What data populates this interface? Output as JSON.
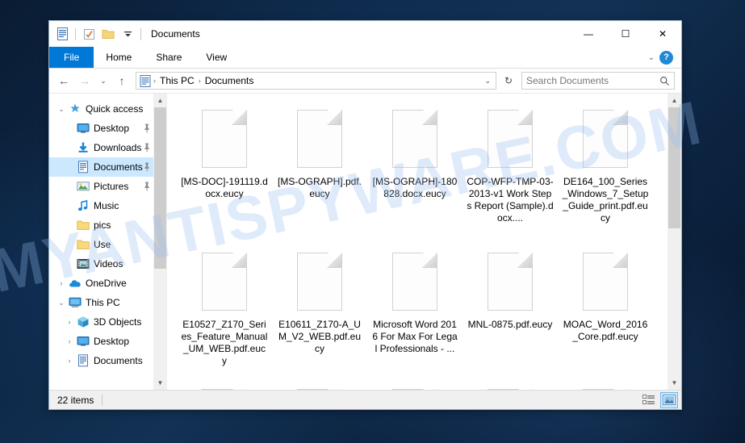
{
  "window": {
    "title": "Documents",
    "quick_access_toolbar": [
      {
        "name": "documents-folder-icon",
        "glyph": "doc"
      },
      {
        "name": "properties-icon",
        "glyph": "check"
      },
      {
        "name": "new-folder-icon",
        "glyph": "folder"
      },
      {
        "name": "customize-qat-dropdown",
        "glyph": "▾"
      }
    ],
    "controls": {
      "minimize": "—",
      "maximize": "☐",
      "close": "✕"
    }
  },
  "ribbon": {
    "tabs": [
      {
        "label": "File",
        "active": true
      },
      {
        "label": "Home",
        "active": false
      },
      {
        "label": "Share",
        "active": false
      },
      {
        "label": "View",
        "active": false
      }
    ],
    "collapse_glyph": "⌄",
    "help_glyph": "?"
  },
  "address": {
    "back_glyph": "←",
    "forward_glyph": "→",
    "recent_glyph": "⌄",
    "up_glyph": "↑",
    "crumbs": [
      "This PC",
      "Documents"
    ],
    "crumb_sep": "›",
    "crumb_chevron": "⌄",
    "refresh_glyph": "↻"
  },
  "search": {
    "placeholder": "Search Documents",
    "icon": "search-icon",
    "icon_glyph": "⌕"
  },
  "sidebar": {
    "items": [
      {
        "label": "Quick access",
        "icon": "pin-star-icon",
        "twisty": "⌄",
        "indent": 0,
        "pinned": false,
        "selected": false
      },
      {
        "label": "Desktop",
        "icon": "desktop-icon",
        "twisty": "",
        "indent": 1,
        "pinned": true,
        "selected": false
      },
      {
        "label": "Downloads",
        "icon": "downloads-icon",
        "twisty": "",
        "indent": 1,
        "pinned": true,
        "selected": false
      },
      {
        "label": "Documents",
        "icon": "documents-icon",
        "twisty": "",
        "indent": 1,
        "pinned": true,
        "selected": true
      },
      {
        "label": "Pictures",
        "icon": "pictures-icon",
        "twisty": "",
        "indent": 1,
        "pinned": true,
        "selected": false
      },
      {
        "label": "Music",
        "icon": "music-icon",
        "twisty": "",
        "indent": 1,
        "pinned": false,
        "selected": false
      },
      {
        "label": "pics",
        "icon": "folder-icon",
        "twisty": "",
        "indent": 1,
        "pinned": false,
        "selected": false
      },
      {
        "label": "Use",
        "icon": "folder-icon",
        "twisty": "",
        "indent": 1,
        "pinned": false,
        "selected": false
      },
      {
        "label": "Videos",
        "icon": "videos-icon",
        "twisty": "",
        "indent": 1,
        "pinned": false,
        "selected": false
      },
      {
        "label": "OneDrive",
        "icon": "onedrive-icon",
        "twisty": "›",
        "indent": 0,
        "pinned": false,
        "selected": false
      },
      {
        "label": "This PC",
        "icon": "this-pc-icon",
        "twisty": "⌄",
        "indent": 0,
        "pinned": false,
        "selected": false
      },
      {
        "label": "3D Objects",
        "icon": "3d-objects-icon",
        "twisty": "›",
        "indent": 1,
        "pinned": false,
        "selected": false
      },
      {
        "label": "Desktop",
        "icon": "desktop-icon",
        "twisty": "›",
        "indent": 1,
        "pinned": false,
        "selected": false
      },
      {
        "label": "Documents",
        "icon": "documents-icon",
        "twisty": "›",
        "indent": 1,
        "pinned": false,
        "selected": false
      }
    ]
  },
  "files": [
    {
      "name": "[MS-DOC]-191119.docx.eucy",
      "type": "file"
    },
    {
      "name": "[MS-OGRAPH].pdf.eucy",
      "type": "file"
    },
    {
      "name": "[MS-OGRAPH]-180828.docx.eucy",
      "type": "file"
    },
    {
      "name": "COP-WFP-TMP-03-2013-v1 Work Steps Report (Sample).docx....",
      "type": "file"
    },
    {
      "name": "DE164_100_Series_Windows_7_Setup_Guide_print.pdf.eucy",
      "type": "file"
    },
    {
      "name": "E10527_Z170_Series_Feature_Manual_UM_WEB.pdf.eucy",
      "type": "file"
    },
    {
      "name": "E10611_Z170-A_UM_V2_WEB.pdf.eucy",
      "type": "file"
    },
    {
      "name": "Microsoft Word 2016 For Max For Legal Professionals - ...",
      "type": "file"
    },
    {
      "name": "MNL-0875.pdf.eucy",
      "type": "file"
    },
    {
      "name": "MOAC_Word_2016_Core.pdf.eucy",
      "type": "file"
    }
  ],
  "statusbar": {
    "item_count": "22 items",
    "view_details_icon": "details-view-icon",
    "view_large_icons_icon": "large-icons-view-icon"
  },
  "watermark": {
    "text": "MYANTISPYWARE.COM"
  },
  "colors": {
    "accent": "#0078d7",
    "selection": "#cce8ff",
    "desktop": "#0d2847"
  }
}
